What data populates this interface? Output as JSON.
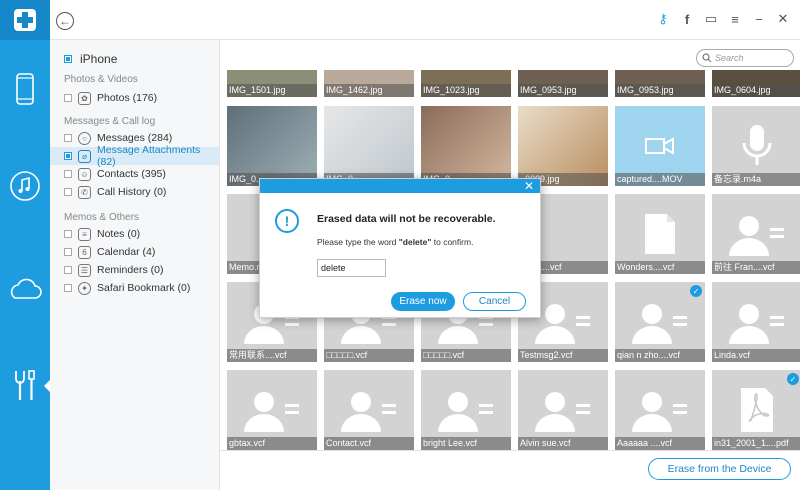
{
  "app": {
    "rail": [
      "phone-icon",
      "music-icon",
      "cloud-icon",
      "tools-icon"
    ]
  },
  "device": {
    "name": "iPhone"
  },
  "sidebar": {
    "sections": [
      {
        "title": "Photos & Videos",
        "items": [
          {
            "label": "Photos (176)",
            "icon": "photos-icon"
          }
        ]
      },
      {
        "title": "Messages & Call log",
        "items": [
          {
            "label": "Messages (284)",
            "icon": "messages-icon"
          },
          {
            "label": "Message Attachments (82)",
            "icon": "attachment-icon",
            "selected": true
          },
          {
            "label": "Contacts (395)",
            "icon": "contacts-icon"
          },
          {
            "label": "Call History (0)",
            "icon": "call-icon"
          }
        ]
      },
      {
        "title": "Memos & Others",
        "items": [
          {
            "label": "Notes (0)",
            "icon": "notes-icon"
          },
          {
            "label": "Calendar (4)",
            "icon": "calendar-icon"
          },
          {
            "label": "Reminders (0)",
            "icon": "reminders-icon"
          },
          {
            "label": "Safari Bookmark (0)",
            "icon": "bookmark-icon"
          }
        ]
      }
    ]
  },
  "search": {
    "placeholder": "Search"
  },
  "grid": {
    "row1": [
      "IMG_1501.jpg",
      "IMG_1462.jpg",
      "IMG_1023.jpg",
      "IMG_0953.jpg",
      "IMG_0953.jpg",
      "IMG_0604.jpg"
    ],
    "row2": [
      "IMG_0...",
      "IMG_0...",
      "IMG_0...",
      "..0009.jpg",
      "captured....MOV",
      "备忘录.m4a"
    ],
    "row3": [
      "Memo.m...",
      "",
      "",
      "...om....vcf",
      "Wonders....vcf",
      "前往 Fran....vcf"
    ],
    "row4": [
      "常用联系....vcf",
      "□□□□□.vcf",
      "□□□□□.vcf",
      "Testmsg2.vcf",
      "qian n zho....vcf",
      "Linda.vcf"
    ],
    "row5": [
      "gbtax.vcf",
      "Contact.vcf",
      "bright Lee.vcf",
      "Alvin sue.vcf",
      "Aaaaaa ....vcf",
      "in31_2001_1....pdf"
    ]
  },
  "footer": {
    "erase_label": "Erase from the Device"
  },
  "dialog": {
    "title": "Erased data will not be recoverable.",
    "msg_before": "Please type the word ",
    "msg_word": "\"delete\"",
    "msg_after": " to confirm.",
    "input_value": "delete",
    "erase_label": "Erase now",
    "cancel_label": "Cancel"
  },
  "colors": {
    "accent": "#1e9ce0"
  }
}
